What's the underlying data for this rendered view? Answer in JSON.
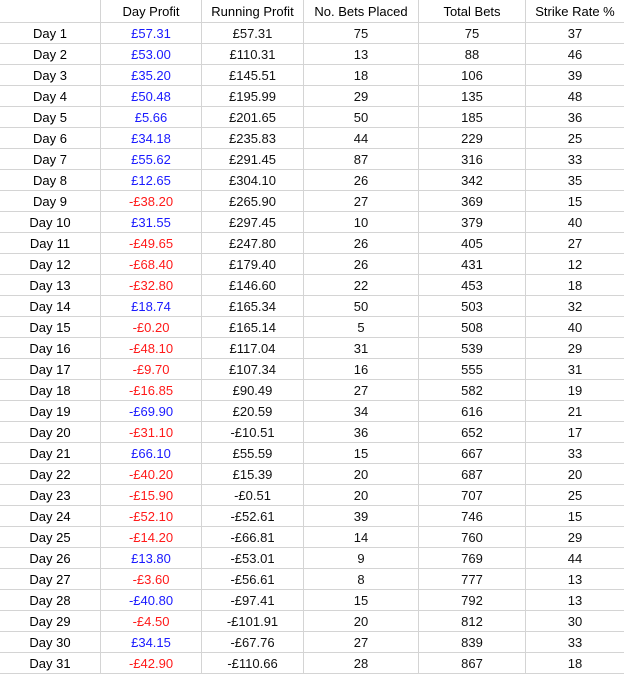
{
  "sheet": {
    "headers": [
      "",
      "Day Profit",
      "Running Profit",
      "No. Bets Placed",
      "Total Bets",
      "Strike Rate %"
    ],
    "colors": {
      "profit_positive": "#1a1aff",
      "profit_negative": "#ff1a1a",
      "grid": "#d4d4d4"
    },
    "rows": [
      {
        "day": "Day 1",
        "day_profit": "£57.31",
        "profit_color": "pos",
        "running_profit": "£57.31",
        "bets_placed": "75",
        "total_bets": "75",
        "strike_rate": "37"
      },
      {
        "day": "Day 2",
        "day_profit": "£53.00",
        "profit_color": "pos",
        "running_profit": "£110.31",
        "bets_placed": "13",
        "total_bets": "88",
        "strike_rate": "46"
      },
      {
        "day": "Day 3",
        "day_profit": "£35.20",
        "profit_color": "pos",
        "running_profit": "£145.51",
        "bets_placed": "18",
        "total_bets": "106",
        "strike_rate": "39"
      },
      {
        "day": "Day 4",
        "day_profit": "£50.48",
        "profit_color": "pos",
        "running_profit": "£195.99",
        "bets_placed": "29",
        "total_bets": "135",
        "strike_rate": "48"
      },
      {
        "day": "Day 5",
        "day_profit": "£5.66",
        "profit_color": "pos",
        "running_profit": "£201.65",
        "bets_placed": "50",
        "total_bets": "185",
        "strike_rate": "36"
      },
      {
        "day": "Day 6",
        "day_profit": "£34.18",
        "profit_color": "pos",
        "running_profit": "£235.83",
        "bets_placed": "44",
        "total_bets": "229",
        "strike_rate": "25"
      },
      {
        "day": "Day 7",
        "day_profit": "£55.62",
        "profit_color": "pos",
        "running_profit": "£291.45",
        "bets_placed": "87",
        "total_bets": "316",
        "strike_rate": "33"
      },
      {
        "day": "Day 8",
        "day_profit": "£12.65",
        "profit_color": "pos",
        "running_profit": "£304.10",
        "bets_placed": "26",
        "total_bets": "342",
        "strike_rate": "35"
      },
      {
        "day": "Day 9",
        "day_profit": "-£38.20",
        "profit_color": "neg",
        "running_profit": "£265.90",
        "bets_placed": "27",
        "total_bets": "369",
        "strike_rate": "15"
      },
      {
        "day": "Day 10",
        "day_profit": "£31.55",
        "profit_color": "pos",
        "running_profit": "£297.45",
        "bets_placed": "10",
        "total_bets": "379",
        "strike_rate": "40"
      },
      {
        "day": "Day 11",
        "day_profit": "-£49.65",
        "profit_color": "neg",
        "running_profit": "£247.80",
        "bets_placed": "26",
        "total_bets": "405",
        "strike_rate": "27"
      },
      {
        "day": "Day 12",
        "day_profit": "-£68.40",
        "profit_color": "neg",
        "running_profit": "£179.40",
        "bets_placed": "26",
        "total_bets": "431",
        "strike_rate": "12"
      },
      {
        "day": "Day 13",
        "day_profit": "-£32.80",
        "profit_color": "neg",
        "running_profit": "£146.60",
        "bets_placed": "22",
        "total_bets": "453",
        "strike_rate": "18"
      },
      {
        "day": "Day 14",
        "day_profit": "£18.74",
        "profit_color": "pos",
        "running_profit": "£165.34",
        "bets_placed": "50",
        "total_bets": "503",
        "strike_rate": "32"
      },
      {
        "day": "Day 15",
        "day_profit": "-£0.20",
        "profit_color": "neg",
        "running_profit": "£165.14",
        "bets_placed": "5",
        "total_bets": "508",
        "strike_rate": "40"
      },
      {
        "day": "Day 16",
        "day_profit": "-£48.10",
        "profit_color": "neg",
        "running_profit": "£117.04",
        "bets_placed": "31",
        "total_bets": "539",
        "strike_rate": "29"
      },
      {
        "day": "Day 17",
        "day_profit": "-£9.70",
        "profit_color": "neg",
        "running_profit": "£107.34",
        "bets_placed": "16",
        "total_bets": "555",
        "strike_rate": "31"
      },
      {
        "day": "Day 18",
        "day_profit": "-£16.85",
        "profit_color": "neg",
        "running_profit": "£90.49",
        "bets_placed": "27",
        "total_bets": "582",
        "strike_rate": "19"
      },
      {
        "day": "Day 19",
        "day_profit": "-£69.90",
        "profit_color": "pos",
        "running_profit": "£20.59",
        "bets_placed": "34",
        "total_bets": "616",
        "strike_rate": "21"
      },
      {
        "day": "Day 20",
        "day_profit": "-£31.10",
        "profit_color": "neg",
        "running_profit": "-£10.51",
        "bets_placed": "36",
        "total_bets": "652",
        "strike_rate": "17"
      },
      {
        "day": "Day 21",
        "day_profit": "£66.10",
        "profit_color": "pos",
        "running_profit": "£55.59",
        "bets_placed": "15",
        "total_bets": "667",
        "strike_rate": "33"
      },
      {
        "day": "Day 22",
        "day_profit": "-£40.20",
        "profit_color": "neg",
        "running_profit": "£15.39",
        "bets_placed": "20",
        "total_bets": "687",
        "strike_rate": "20"
      },
      {
        "day": "Day 23",
        "day_profit": "-£15.90",
        "profit_color": "neg",
        "running_profit": "-£0.51",
        "bets_placed": "20",
        "total_bets": "707",
        "strike_rate": "25"
      },
      {
        "day": "Day 24",
        "day_profit": "-£52.10",
        "profit_color": "neg",
        "running_profit": "-£52.61",
        "bets_placed": "39",
        "total_bets": "746",
        "strike_rate": "15"
      },
      {
        "day": "Day 25",
        "day_profit": "-£14.20",
        "profit_color": "neg plain",
        "running_profit": "-£66.81",
        "bets_placed": "14",
        "total_bets": "760",
        "strike_rate": "29"
      },
      {
        "day": "Day 26",
        "day_profit": "£13.80",
        "profit_color": "pos",
        "running_profit": "-£53.01",
        "bets_placed": "9",
        "total_bets": "769",
        "strike_rate": "44"
      },
      {
        "day": "Day 27",
        "day_profit": "-£3.60",
        "profit_color": "neg",
        "running_profit": "-£56.61",
        "bets_placed": "8",
        "total_bets": "777",
        "strike_rate": "13"
      },
      {
        "day": "Day 28",
        "day_profit": "-£40.80",
        "profit_color": "pos",
        "running_profit": "-£97.41",
        "bets_placed": "15",
        "total_bets": "792",
        "strike_rate": "13"
      },
      {
        "day": "Day 29",
        "day_profit": "-£4.50",
        "profit_color": "neg",
        "running_profit": "-£101.91",
        "bets_placed": "20",
        "total_bets": "812",
        "strike_rate": "30"
      },
      {
        "day": "Day 30",
        "day_profit": "£34.15",
        "profit_color": "pos",
        "running_profit": "-£67.76",
        "bets_placed": "27",
        "total_bets": "839",
        "strike_rate": "33"
      },
      {
        "day": "Day 31",
        "day_profit": "-£42.90",
        "profit_color": "neg",
        "running_profit": "-£110.66",
        "bets_placed": "28",
        "total_bets": "867",
        "strike_rate": "18"
      }
    ]
  }
}
